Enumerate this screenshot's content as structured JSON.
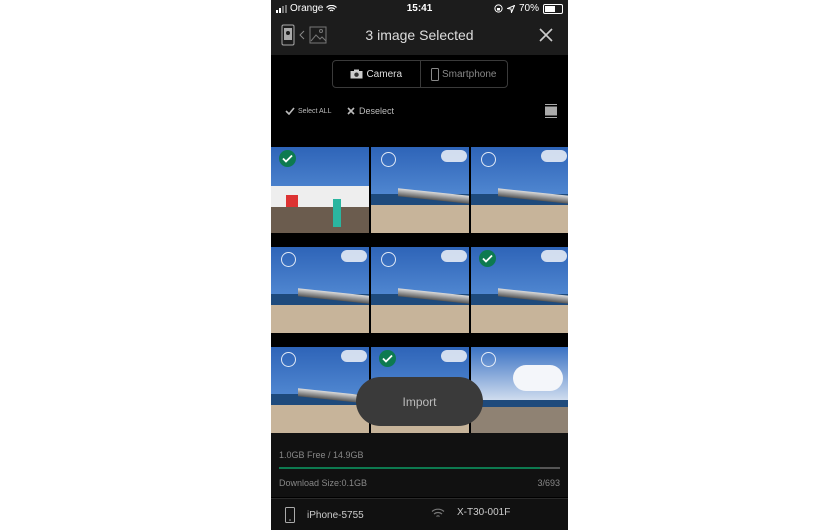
{
  "status_bar": {
    "carrier": "Orange",
    "time": "15:41",
    "battery": "70%",
    "battery_level": 0.7
  },
  "header": {
    "title": "3 image Selected"
  },
  "source_tabs": [
    {
      "label": "Camera",
      "icon": "camera-icon",
      "active": true
    },
    {
      "label": "Smartphone",
      "icon": "smartphone-icon",
      "active": false
    }
  ],
  "toolbar": {
    "select_all_label": "Select ALL",
    "deselect_label": "Deselect"
  },
  "images": [
    {
      "selected": true,
      "scene": "people-on-pier"
    },
    {
      "selected": false,
      "scene": "pier-beach"
    },
    {
      "selected": false,
      "scene": "pier-beach"
    },
    {
      "selected": false,
      "scene": "pier-beach"
    },
    {
      "selected": false,
      "scene": "pier-beach"
    },
    {
      "selected": true,
      "scene": "pier-beach"
    },
    {
      "selected": false,
      "scene": "pier-beach"
    },
    {
      "selected": true,
      "scene": "pier-beach"
    },
    {
      "selected": false,
      "scene": "clouds-beach"
    }
  ],
  "import_button": {
    "label": "Import"
  },
  "storage": {
    "free_label": "1.0GB Free / 14.9GB",
    "used_fraction": 0.93,
    "download_size_label": "Download Size:0.1GB",
    "count_label": "3/693"
  },
  "footer": {
    "device_name": "iPhone-5755",
    "camera_name": "X-T30-001F"
  },
  "colors": {
    "accent": "#0d7a50"
  }
}
